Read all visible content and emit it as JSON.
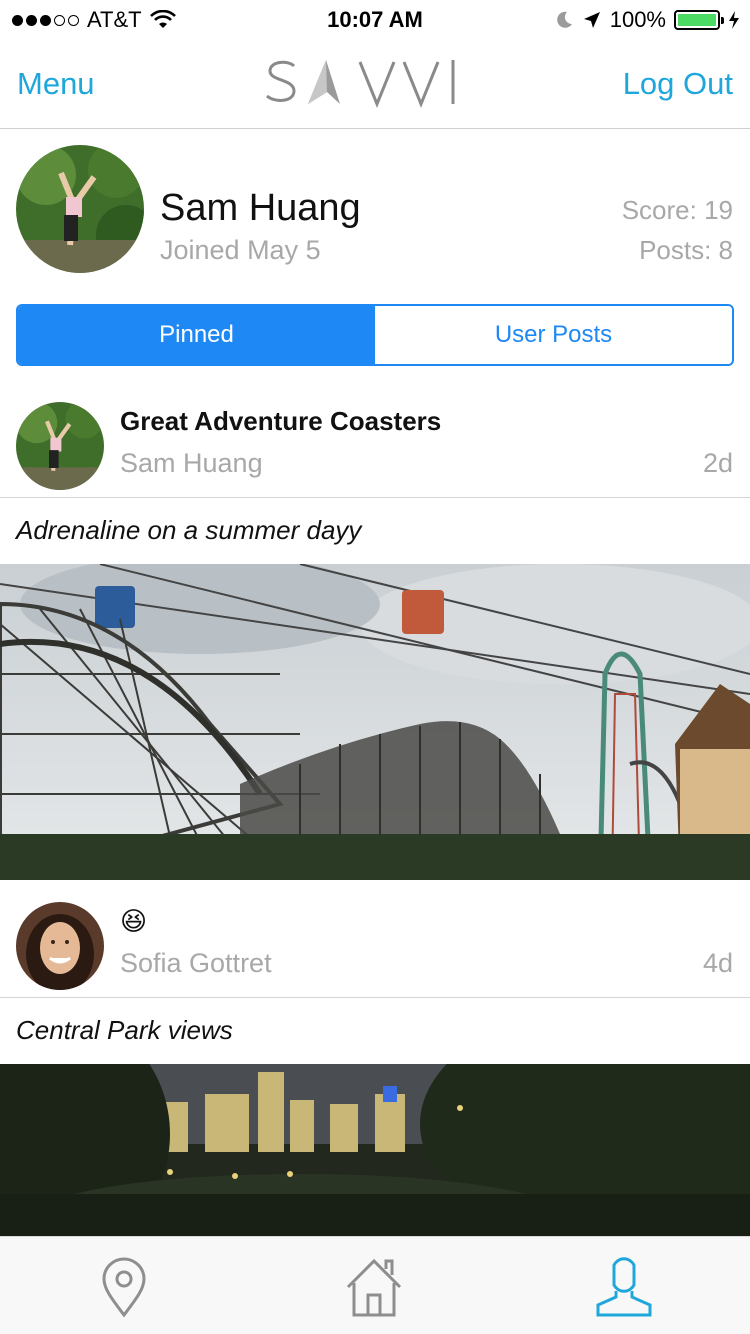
{
  "status_bar": {
    "carrier": "AT&T",
    "time": "10:07 AM",
    "battery": "100%",
    "signal_bars_filled": 3,
    "signal_bars_total": 5,
    "battery_level": 1.0
  },
  "nav": {
    "menu_label": "Menu",
    "logo_text": "SAVVI",
    "logout_label": "Log Out"
  },
  "profile": {
    "name": "Sam Huang",
    "joined": "Joined May 5",
    "score": "Score: 19",
    "posts": "Posts: 8"
  },
  "segments": {
    "pinned": "Pinned",
    "user_posts": "User Posts",
    "selected": "Pinned"
  },
  "posts": [
    {
      "title": "Great Adventure Coasters",
      "author": "Sam Huang",
      "age": "2d",
      "caption": "Adrenaline on a summer dayy"
    },
    {
      "title": "😆",
      "author": "Sofia Gottret",
      "age": "4d",
      "caption": "Central Park views"
    }
  ],
  "tabs": [
    {
      "icon": "map-pin-icon"
    },
    {
      "icon": "home-icon"
    },
    {
      "icon": "profile-icon",
      "active": true
    }
  ],
  "colors": {
    "accent": "#1fa7dc",
    "segment_blue": "#1e88f5",
    "muted_text": "#a8a8a8",
    "battery_green": "#4cd964"
  }
}
